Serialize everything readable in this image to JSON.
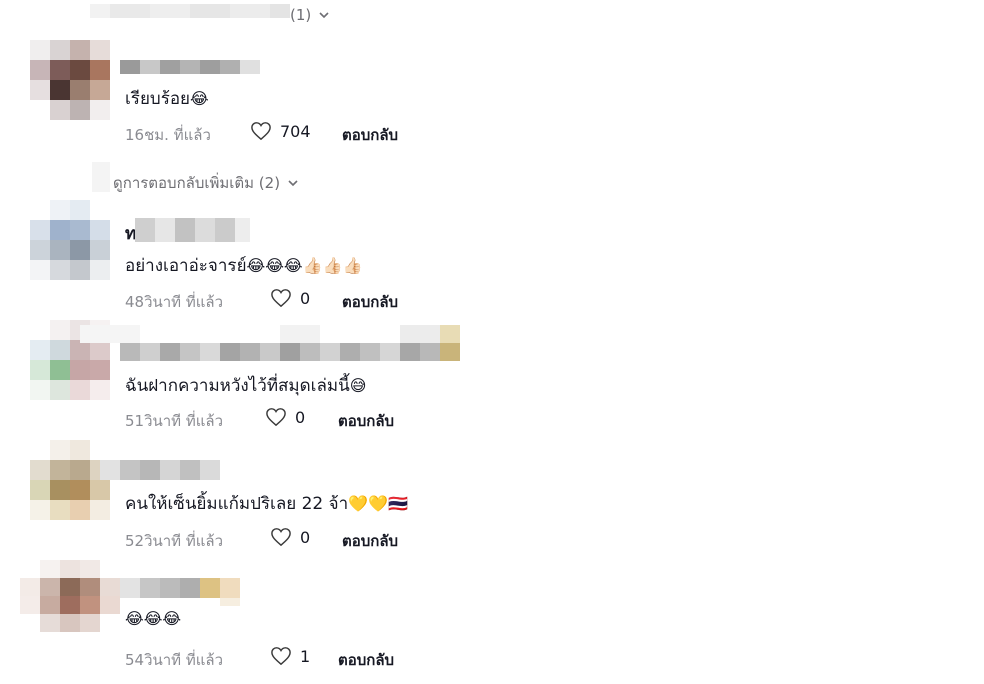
{
  "thread": {
    "top_view_more": {
      "label": "(1)"
    },
    "mid_view_more": {
      "label": "ดูการตอบกลับเพิ่มเติม (2)"
    }
  },
  "comments": [
    {
      "text": "เรียบร้อย",
      "emoji": "😂",
      "time": "16ชม. ที่แล้ว",
      "likes": "704",
      "reply_label": "ตอบกลับ"
    },
    {
      "name_initial": "ท",
      "text": "อย่างเอาอ่ะจารย์",
      "emoji": "😂😂😂👍🏻👍🏻👍🏻",
      "time": "48วินาที ที่แล้ว",
      "likes": "0",
      "reply_label": "ตอบกลับ"
    },
    {
      "text": "ฉันฝากความหวังไว้ที่สมุดเล่มนี้",
      "emoji": "😅",
      "time": "51วินาที ที่แล้ว",
      "likes": "0",
      "reply_label": "ตอบกลับ"
    },
    {
      "text": "คนให้เซ็นยิ้มแก้มปริเลย 22 จ้า",
      "emoji": "💛💛🇹🇭",
      "time": "52วินาที ที่แล้ว",
      "likes": "0",
      "reply_label": "ตอบกลับ"
    },
    {
      "text": "",
      "emoji": "😂😂😂",
      "time": "54วินาที ที่แล้ว",
      "likes": "1",
      "reply_label": "ตอบกลับ"
    }
  ],
  "colors": {
    "text": "#161823",
    "meta": "#8a8b91",
    "heart_outline": "#3a3a3a"
  },
  "icons": {
    "like": "heart-outline-icon",
    "expand": "chevron-down-icon"
  }
}
